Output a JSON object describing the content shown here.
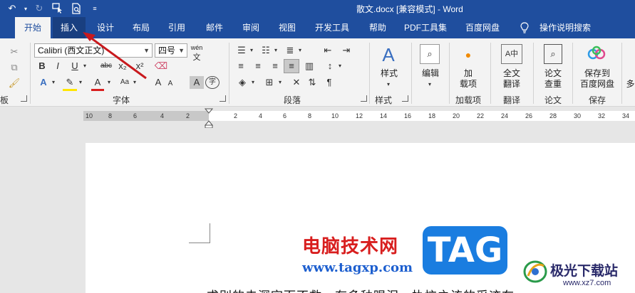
{
  "window": {
    "title": "散文.docx [兼容模式]  -  Word"
  },
  "quick_access": {
    "undo_icon": "undo-icon",
    "redo_icon": "redo-icon",
    "touch_icon": "touch-mode-icon",
    "preview_icon": "print-preview-icon",
    "customize_icon": "customize-qat-icon"
  },
  "tabs": {
    "file": "",
    "home": "开始",
    "insert": "插入",
    "design": "设计",
    "layout": "布局",
    "references": "引用",
    "mailings": "邮件",
    "review": "审阅",
    "view": "视图",
    "developer": "开发工具",
    "help": "帮助",
    "pdf": "PDF工具集",
    "baidu": "百度网盘",
    "tell_me": "操作说明搜索"
  },
  "ribbon": {
    "font_name": "Calibri (西文正文)",
    "font_size": "四号",
    "phonetic_label": "wén",
    "bold": "B",
    "italic": "I",
    "underline": "U",
    "strikethrough": "abc",
    "subscript": "x₂",
    "superscript": "x²",
    "font_color_letter": "A",
    "grow_font": "A",
    "shrink_font": "A",
    "change_case": "Aa",
    "enclose_char": "字",
    "clipboard_label": "板",
    "font_group_label": "字体",
    "paragraph_group_label": "段落",
    "styles_button": "样式",
    "styles_group_label": "样式",
    "edit_button": "编辑",
    "addin_button_line1": "加",
    "addin_button_line2": "载项",
    "addin_group_label": "加载项",
    "translate_button_line1": "全文",
    "translate_button_line2": "翻译",
    "translate_group_label": "翻译",
    "paper_check_line1": "论文",
    "paper_check_line2": "查重",
    "paper_group_label": "论文",
    "save_baidu_line1": "保存到",
    "save_baidu_line2": "百度网盘",
    "save_group_label": "保存",
    "overflow_label": "多"
  },
  "ruler": {
    "left_numbers": [
      "10",
      "8",
      "6",
      "4",
      "2"
    ],
    "right_numbers": [
      "2",
      "4",
      "6",
      "8",
      "10",
      "12",
      "14",
      "16",
      "18",
      "20",
      "22",
      "24",
      "26",
      "28",
      "30",
      "32",
      "34"
    ]
  },
  "document": {
    "body_text": "求别的去深空而不救，有多种眼泪，执恼之该的采迹在"
  },
  "watermark": {
    "site_name": "电脑技术网",
    "site_url": "www.tagxp.com",
    "logo_text": "TAG",
    "xz_name": "极光下载站",
    "xz_url": "www.xz7.com"
  },
  "colors": {
    "titlebar": "#1f4e9e",
    "ribbon": "#f3f3f3",
    "accent_red": "#d81e1e",
    "watermark_blue": "#1a7de0"
  }
}
